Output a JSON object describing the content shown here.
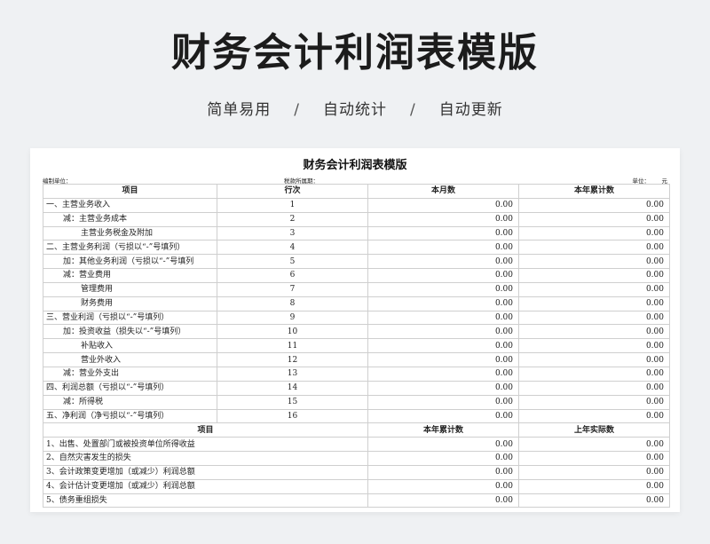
{
  "hero": {
    "title": "财务会计利润表模版",
    "tags": [
      "简单易用",
      "自动统计",
      "自动更新"
    ],
    "separator": "/"
  },
  "sheet": {
    "title": "财务会计利润表模版",
    "meta": {
      "unit_label": "编制单位：",
      "period_label": "税款所属期：",
      "unit_of_measure": "单位：",
      "currency": "元"
    },
    "columns": [
      "项目",
      "行次",
      "本月数",
      "本年累计数"
    ],
    "rows": [
      {
        "item": "一、主营业务收入",
        "indent": 0,
        "line": "1",
        "month": "0.00",
        "ytd": "0.00"
      },
      {
        "item": "减：主营业务成本",
        "indent": 1,
        "line": "2",
        "month": "0.00",
        "ytd": "0.00"
      },
      {
        "item": "主营业务税金及附加",
        "indent": 2,
        "line": "3",
        "month": "0.00",
        "ytd": "0.00"
      },
      {
        "item": "二、主营业务利润（亏损以“-”号填列）",
        "indent": 0,
        "line": "4",
        "month": "0.00",
        "ytd": "0.00"
      },
      {
        "item": "加：其他业务利润（亏损以“-”号填列",
        "indent": 1,
        "line": "5",
        "month": "0.00",
        "ytd": "0.00"
      },
      {
        "item": "减：营业费用",
        "indent": 1,
        "line": "6",
        "month": "0.00",
        "ytd": "0.00"
      },
      {
        "item": "管理费用",
        "indent": 2,
        "line": "7",
        "month": "0.00",
        "ytd": "0.00"
      },
      {
        "item": "财务费用",
        "indent": 2,
        "line": "8",
        "month": "0.00",
        "ytd": "0.00"
      },
      {
        "item": "三、营业利润（亏损以“-”号填列）",
        "indent": 0,
        "line": "9",
        "month": "0.00",
        "ytd": "0.00"
      },
      {
        "item": "加：投资收益（损失以“-”号填列）",
        "indent": 1,
        "line": "10",
        "month": "0.00",
        "ytd": "0.00"
      },
      {
        "item": "补贴收入",
        "indent": 2,
        "line": "11",
        "month": "0.00",
        "ytd": "0.00"
      },
      {
        "item": "营业外收入",
        "indent": 2,
        "line": "12",
        "month": "0.00",
        "ytd": "0.00"
      },
      {
        "item": "减：营业外支出",
        "indent": 1,
        "line": "13",
        "month": "0.00",
        "ytd": "0.00"
      },
      {
        "item": "四、利润总额（亏损以“-”号填列）",
        "indent": 0,
        "line": "14",
        "month": "0.00",
        "ytd": "0.00"
      },
      {
        "item": "减：所得税",
        "indent": 1,
        "line": "15",
        "month": "0.00",
        "ytd": "0.00"
      },
      {
        "item": "五、净利润（净亏损以“-”号填列）",
        "indent": 0,
        "line": "16",
        "month": "0.00",
        "ytd": "0.00"
      }
    ],
    "columns2": [
      "项目",
      "本年累计数",
      "上年实际数"
    ],
    "rows2": [
      {
        "item": "1、出售、处置部门或被投资单位所得收益",
        "ytd": "0.00",
        "prev": "0.00"
      },
      {
        "item": "2、自然灾害发生的损失",
        "ytd": "0.00",
        "prev": "0.00"
      },
      {
        "item": "3、会计政策变更增加（或减少）利润总额",
        "ytd": "0.00",
        "prev": "0.00"
      },
      {
        "item": "4、会计估计变更增加（或减少）利润总额",
        "ytd": "0.00",
        "prev": "0.00"
      },
      {
        "item": "5、债务重组损失",
        "ytd": "0.00",
        "prev": "0.00"
      }
    ]
  }
}
